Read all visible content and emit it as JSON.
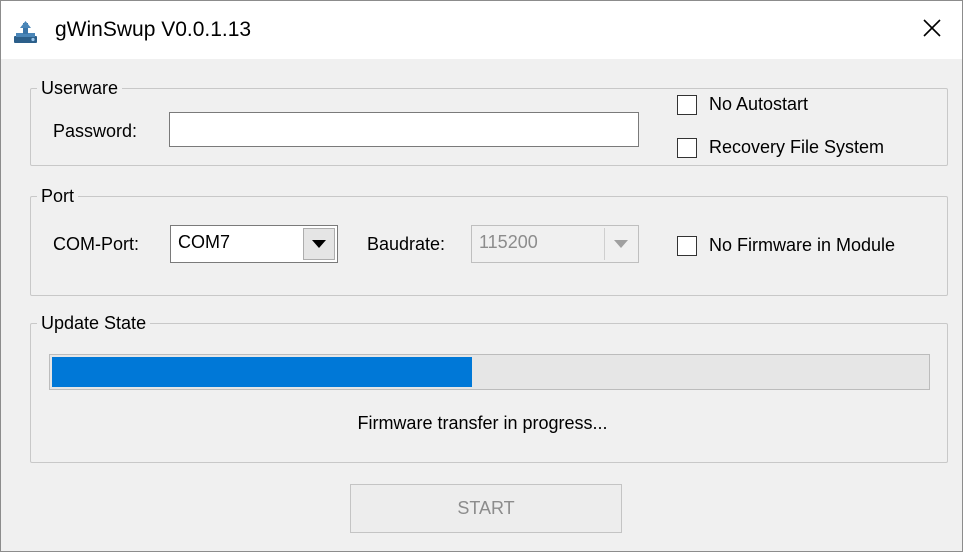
{
  "window": {
    "title": "gWinSwup V0.0.1.13"
  },
  "userware": {
    "group_label": "Userware",
    "password_label": "Password:",
    "password_value": "",
    "no_autostart_label": "No Autostart",
    "no_autostart_checked": false,
    "recovery_fs_label": "Recovery File System",
    "recovery_fs_checked": false
  },
  "port": {
    "group_label": "Port",
    "com_port_label": "COM-Port:",
    "com_port_value": "COM7",
    "baudrate_label": "Baudrate:",
    "baudrate_value": "115200",
    "no_firmware_label": "No Firmware in Module",
    "no_firmware_checked": false
  },
  "update_state": {
    "group_label": "Update State",
    "progress_fraction": 0.48,
    "status_text": "Firmware transfer in progress..."
  },
  "actions": {
    "start_label": "START"
  },
  "colors": {
    "progress_fill": "#0078d7",
    "window_bg": "#f0f0f0"
  },
  "icons": {
    "app": "flash-tool-icon",
    "close": "close-icon",
    "dropdown": "chevron-down-icon"
  }
}
